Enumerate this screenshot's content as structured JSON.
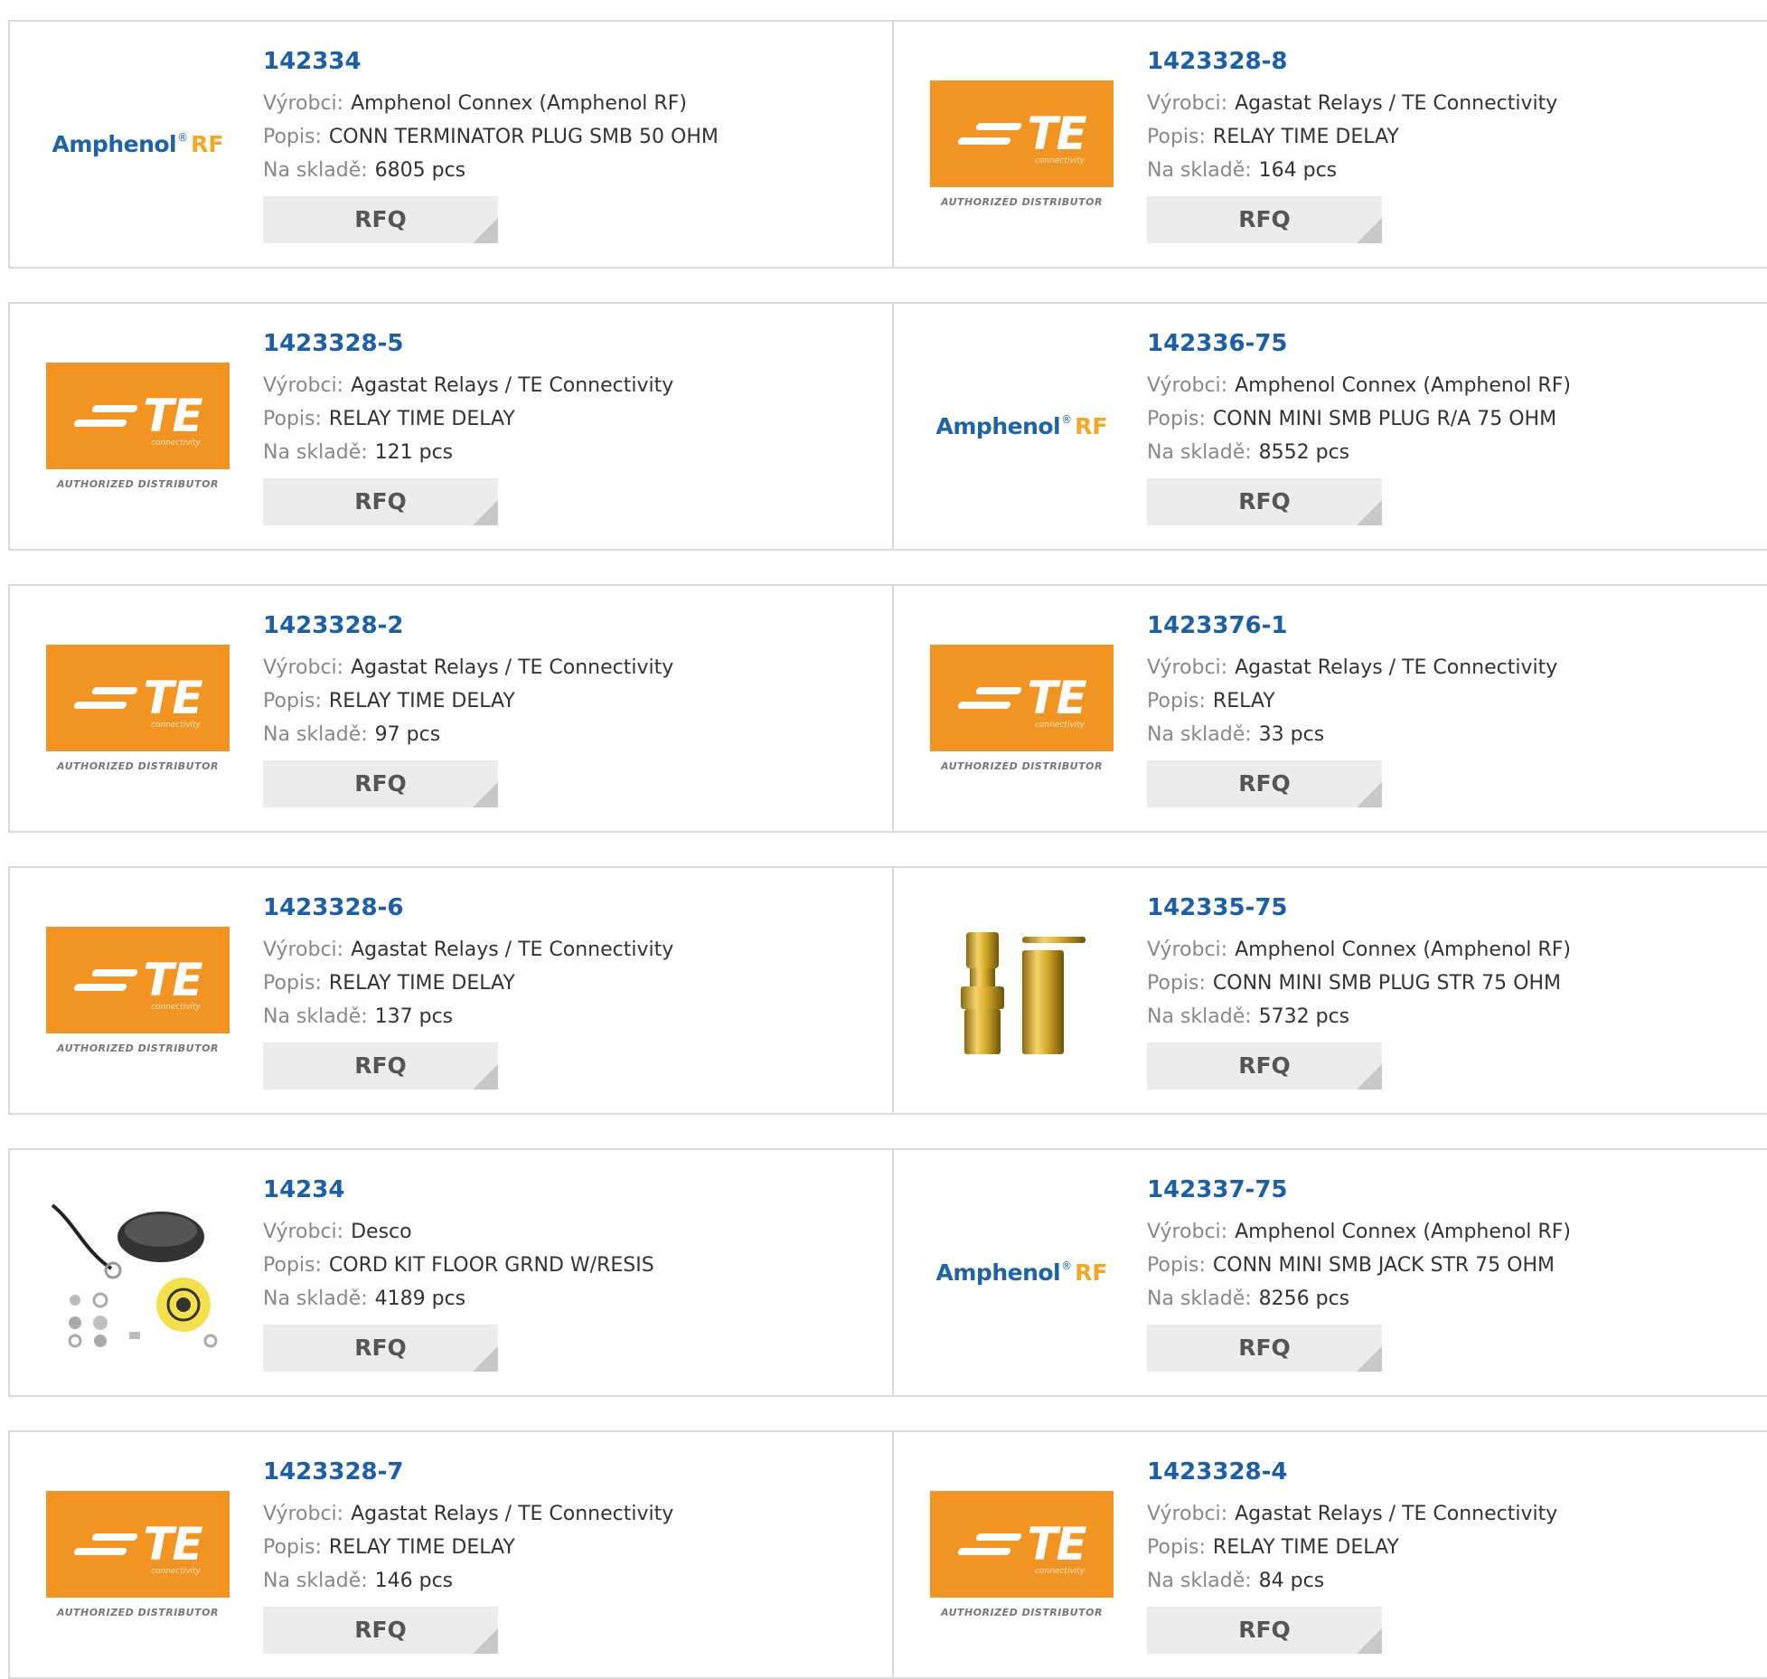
{
  "labels": {
    "manufacturer": "Výrobci:",
    "description": "Popis:",
    "stock": "Na skladě:",
    "rfq": "RFQ"
  },
  "logos": {
    "amphenol": {
      "main": "Amphenol",
      "reg": "®",
      "rf": "RF"
    },
    "te": {
      "letters": "TE",
      "sub": "connectivity",
      "authorized": "AUTHORIZED DISTRIBUTOR"
    }
  },
  "products": [
    {
      "part": "142334",
      "manufacturer": "Amphenol Connex (Amphenol RF)",
      "description": "CONN TERMINATOR PLUG SMB 50 OHM",
      "stock": "6805 pcs",
      "logo": "amphenol"
    },
    {
      "part": "1423328-8",
      "manufacturer": "Agastat Relays / TE Connectivity",
      "description": "RELAY TIME DELAY",
      "stock": "164 pcs",
      "logo": "te"
    },
    {
      "part": "1423328-5",
      "manufacturer": "Agastat Relays / TE Connectivity",
      "description": "RELAY TIME DELAY",
      "stock": "121 pcs",
      "logo": "te"
    },
    {
      "part": "142336-75",
      "manufacturer": "Amphenol Connex (Amphenol RF)",
      "description": "CONN MINI SMB PLUG R/A 75 OHM",
      "stock": "8552 pcs",
      "logo": "amphenol"
    },
    {
      "part": "1423328-2",
      "manufacturer": "Agastat Relays / TE Connectivity",
      "description": "RELAY TIME DELAY",
      "stock": "97 pcs",
      "logo": "te"
    },
    {
      "part": "1423376-1",
      "manufacturer": "Agastat Relays / TE Connectivity",
      "description": "RELAY",
      "stock": "33 pcs",
      "logo": "te"
    },
    {
      "part": "1423328-6",
      "manufacturer": "Agastat Relays / TE Connectivity",
      "description": "RELAY TIME DELAY",
      "stock": "137 pcs",
      "logo": "te"
    },
    {
      "part": "142335-75",
      "manufacturer": "Amphenol Connex (Amphenol RF)",
      "description": "CONN MINI SMB PLUG STR 75 OHM",
      "stock": "5732 pcs",
      "logo": "connector-photo"
    },
    {
      "part": "14234",
      "manufacturer": "Desco",
      "description": "CORD KIT FLOOR GRND W/RESIS",
      "stock": "4189 pcs",
      "logo": "cord-kit-photo"
    },
    {
      "part": "142337-75",
      "manufacturer": "Amphenol Connex (Amphenol RF)",
      "description": "CONN MINI SMB JACK STR 75 OHM",
      "stock": "8256 pcs",
      "logo": "amphenol"
    },
    {
      "part": "1423328-7",
      "manufacturer": "Agastat Relays / TE Connectivity",
      "description": "RELAY TIME DELAY",
      "stock": "146 pcs",
      "logo": "te"
    },
    {
      "part": "1423328-4",
      "manufacturer": "Agastat Relays / TE Connectivity",
      "description": "RELAY TIME DELAY",
      "stock": "84 pcs",
      "logo": "te"
    }
  ]
}
